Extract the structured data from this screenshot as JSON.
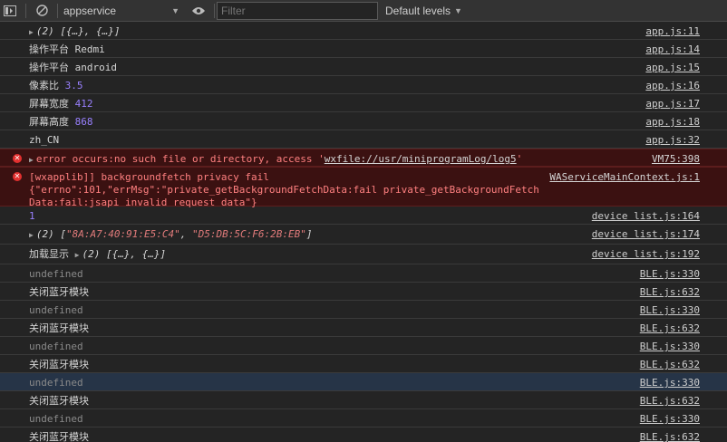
{
  "toolbar": {
    "context": "appservice",
    "filter_placeholder": "Filter",
    "levels_label": "Default levels"
  },
  "logs": [
    {
      "type": "obj",
      "text": "(2) [{…}, {…}]",
      "src": "app.js:11"
    },
    {
      "label": "操作平台",
      "value": "Redmi",
      "src": "app.js:14"
    },
    {
      "label": "操作平台",
      "value": "android",
      "src": "app.js:15"
    },
    {
      "label": "像素比",
      "num": "3.5",
      "src": "app.js:16"
    },
    {
      "label": "屏幕宽度",
      "num": "412",
      "src": "app.js:17"
    },
    {
      "label": "屏幕高度",
      "num": "868",
      "src": "app.js:18"
    },
    {
      "label": "zh_CN",
      "src": "app.js:32"
    },
    {
      "type": "error",
      "pre": "error occurs:no such file or directory, access '",
      "link": "wxfile://usr/miniprogramLog/log5",
      "post": "'",
      "src": "VM75:398"
    },
    {
      "type": "error",
      "text": "[wxapplib]] backgroundfetch privacy fail\n{\"errno\":101,\"errMsg\":\"private_getBackgroundFetchData:fail private_getBackgroundFetchData:fail:jsapi invalid request data\"}",
      "src": "WAServiceMainContext.js:1"
    },
    {
      "num": "1",
      "src": "device list.js:164"
    },
    {
      "type": "arr",
      "prefix": "(2) [",
      "a": "\"8A:A7:40:91:E5:C4\"",
      "b": "\"D5:DB:5C:F6:2B:EB\"",
      "suffix": "]",
      "src": "device list.js:174"
    },
    {
      "label": "加载显示",
      "obj": "(2) [{…}, {…}]",
      "src": "device list.js:192"
    },
    {
      "undef": "undefined",
      "src": "BLE.js:330"
    },
    {
      "label": "关闭蓝牙模块",
      "src": "BLE.js:632"
    },
    {
      "undef": "undefined",
      "src": "BLE.js:330"
    },
    {
      "label": "关闭蓝牙模块",
      "src": "BLE.js:632"
    },
    {
      "undef": "undefined",
      "src": "BLE.js:330"
    },
    {
      "label": "关闭蓝牙模块",
      "src": "BLE.js:632"
    },
    {
      "undef": "undefined",
      "src": "BLE.js:330",
      "selected": true
    },
    {
      "label": "关闭蓝牙模块",
      "src": "BLE.js:632"
    },
    {
      "undef": "undefined",
      "src": "BLE.js:330"
    },
    {
      "label": "关闭蓝牙模块",
      "src": "BLE.js:632"
    }
  ]
}
